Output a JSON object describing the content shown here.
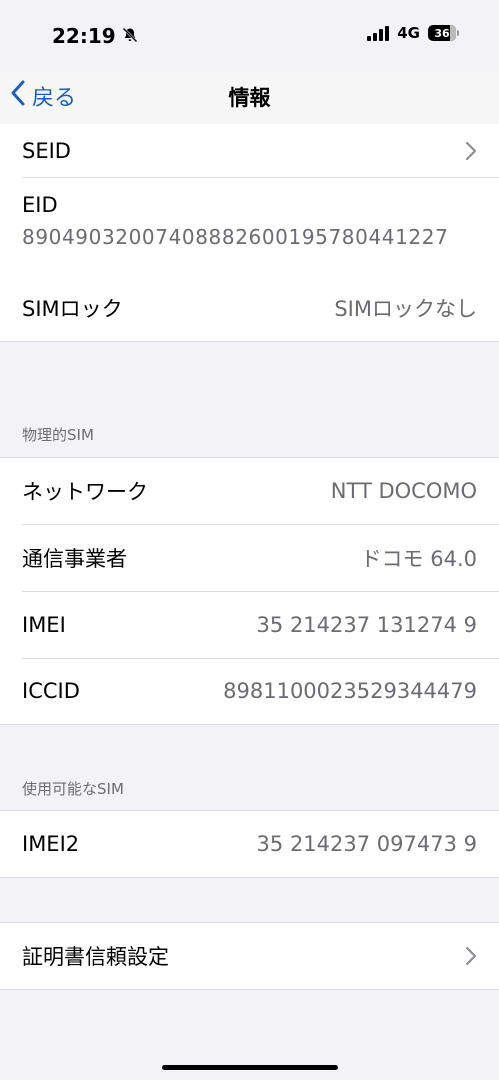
{
  "status_bar": {
    "time": "22:19",
    "network": "4G",
    "battery": "36"
  },
  "nav": {
    "back_label": "戻る",
    "title": "情報"
  },
  "top_group": {
    "seid_label": "SEID",
    "eid_label": "EID",
    "eid_value": "89049032007408882600195780441227",
    "simlock_label": "SIMロック",
    "simlock_value": "SIMロックなし"
  },
  "physical_sim": {
    "header": "物理的SIM",
    "rows": [
      {
        "label": "ネットワーク",
        "value": "NTT DOCOMO"
      },
      {
        "label": "通信事業者",
        "value": "ドコモ 64.0"
      },
      {
        "label": "IMEI",
        "value": "35 214237 131274 9"
      },
      {
        "label": "ICCID",
        "value": "8981100023529344479"
      }
    ]
  },
  "available_sim": {
    "header": "使用可能なSIM",
    "rows": [
      {
        "label": "IMEI2",
        "value": "35 214237 097473 9"
      }
    ]
  },
  "trust_group": {
    "label": "証明書信頼設定"
  },
  "colors": {
    "accent": "#1c5fb8",
    "background": "#f2f2f7",
    "secondary_text": "#6b6b70"
  }
}
